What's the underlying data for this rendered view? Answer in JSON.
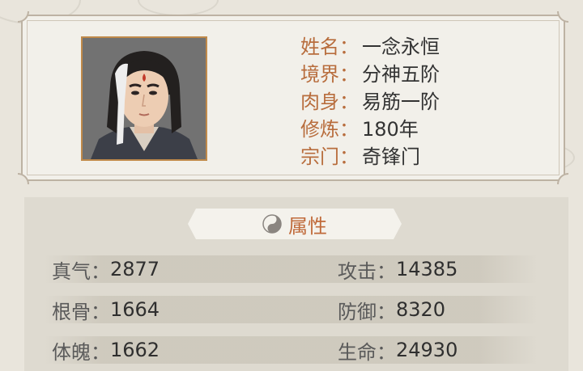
{
  "profile": {
    "portrait_icon": "character-portrait",
    "fields": [
      {
        "key": "姓名：",
        "value": "一念永恒"
      },
      {
        "key": "境界：",
        "value": "分神五阶"
      },
      {
        "key": "肉身：",
        "value": "易筋一阶"
      },
      {
        "key": "修炼：",
        "value": "180年"
      },
      {
        "key": "宗门：",
        "value": "奇锋门"
      }
    ]
  },
  "attributes": {
    "title": "属性",
    "title_icon": "yin-yang-icon",
    "rows": [
      {
        "left_key": "真气：",
        "left_value": "2877",
        "right_key": "攻击：",
        "right_value": "14385"
      },
      {
        "left_key": "根骨：",
        "left_value": "1664",
        "right_key": "防御：",
        "right_value": "8320"
      },
      {
        "left_key": "体魄：",
        "left_value": "1662",
        "right_key": "生命：",
        "right_value": "24930"
      }
    ]
  },
  "colors": {
    "label_accent": "#b86d3d",
    "frame": "#bdb2a3",
    "portrait_border": "#c08a4a",
    "background": "#e9e5dc"
  }
}
